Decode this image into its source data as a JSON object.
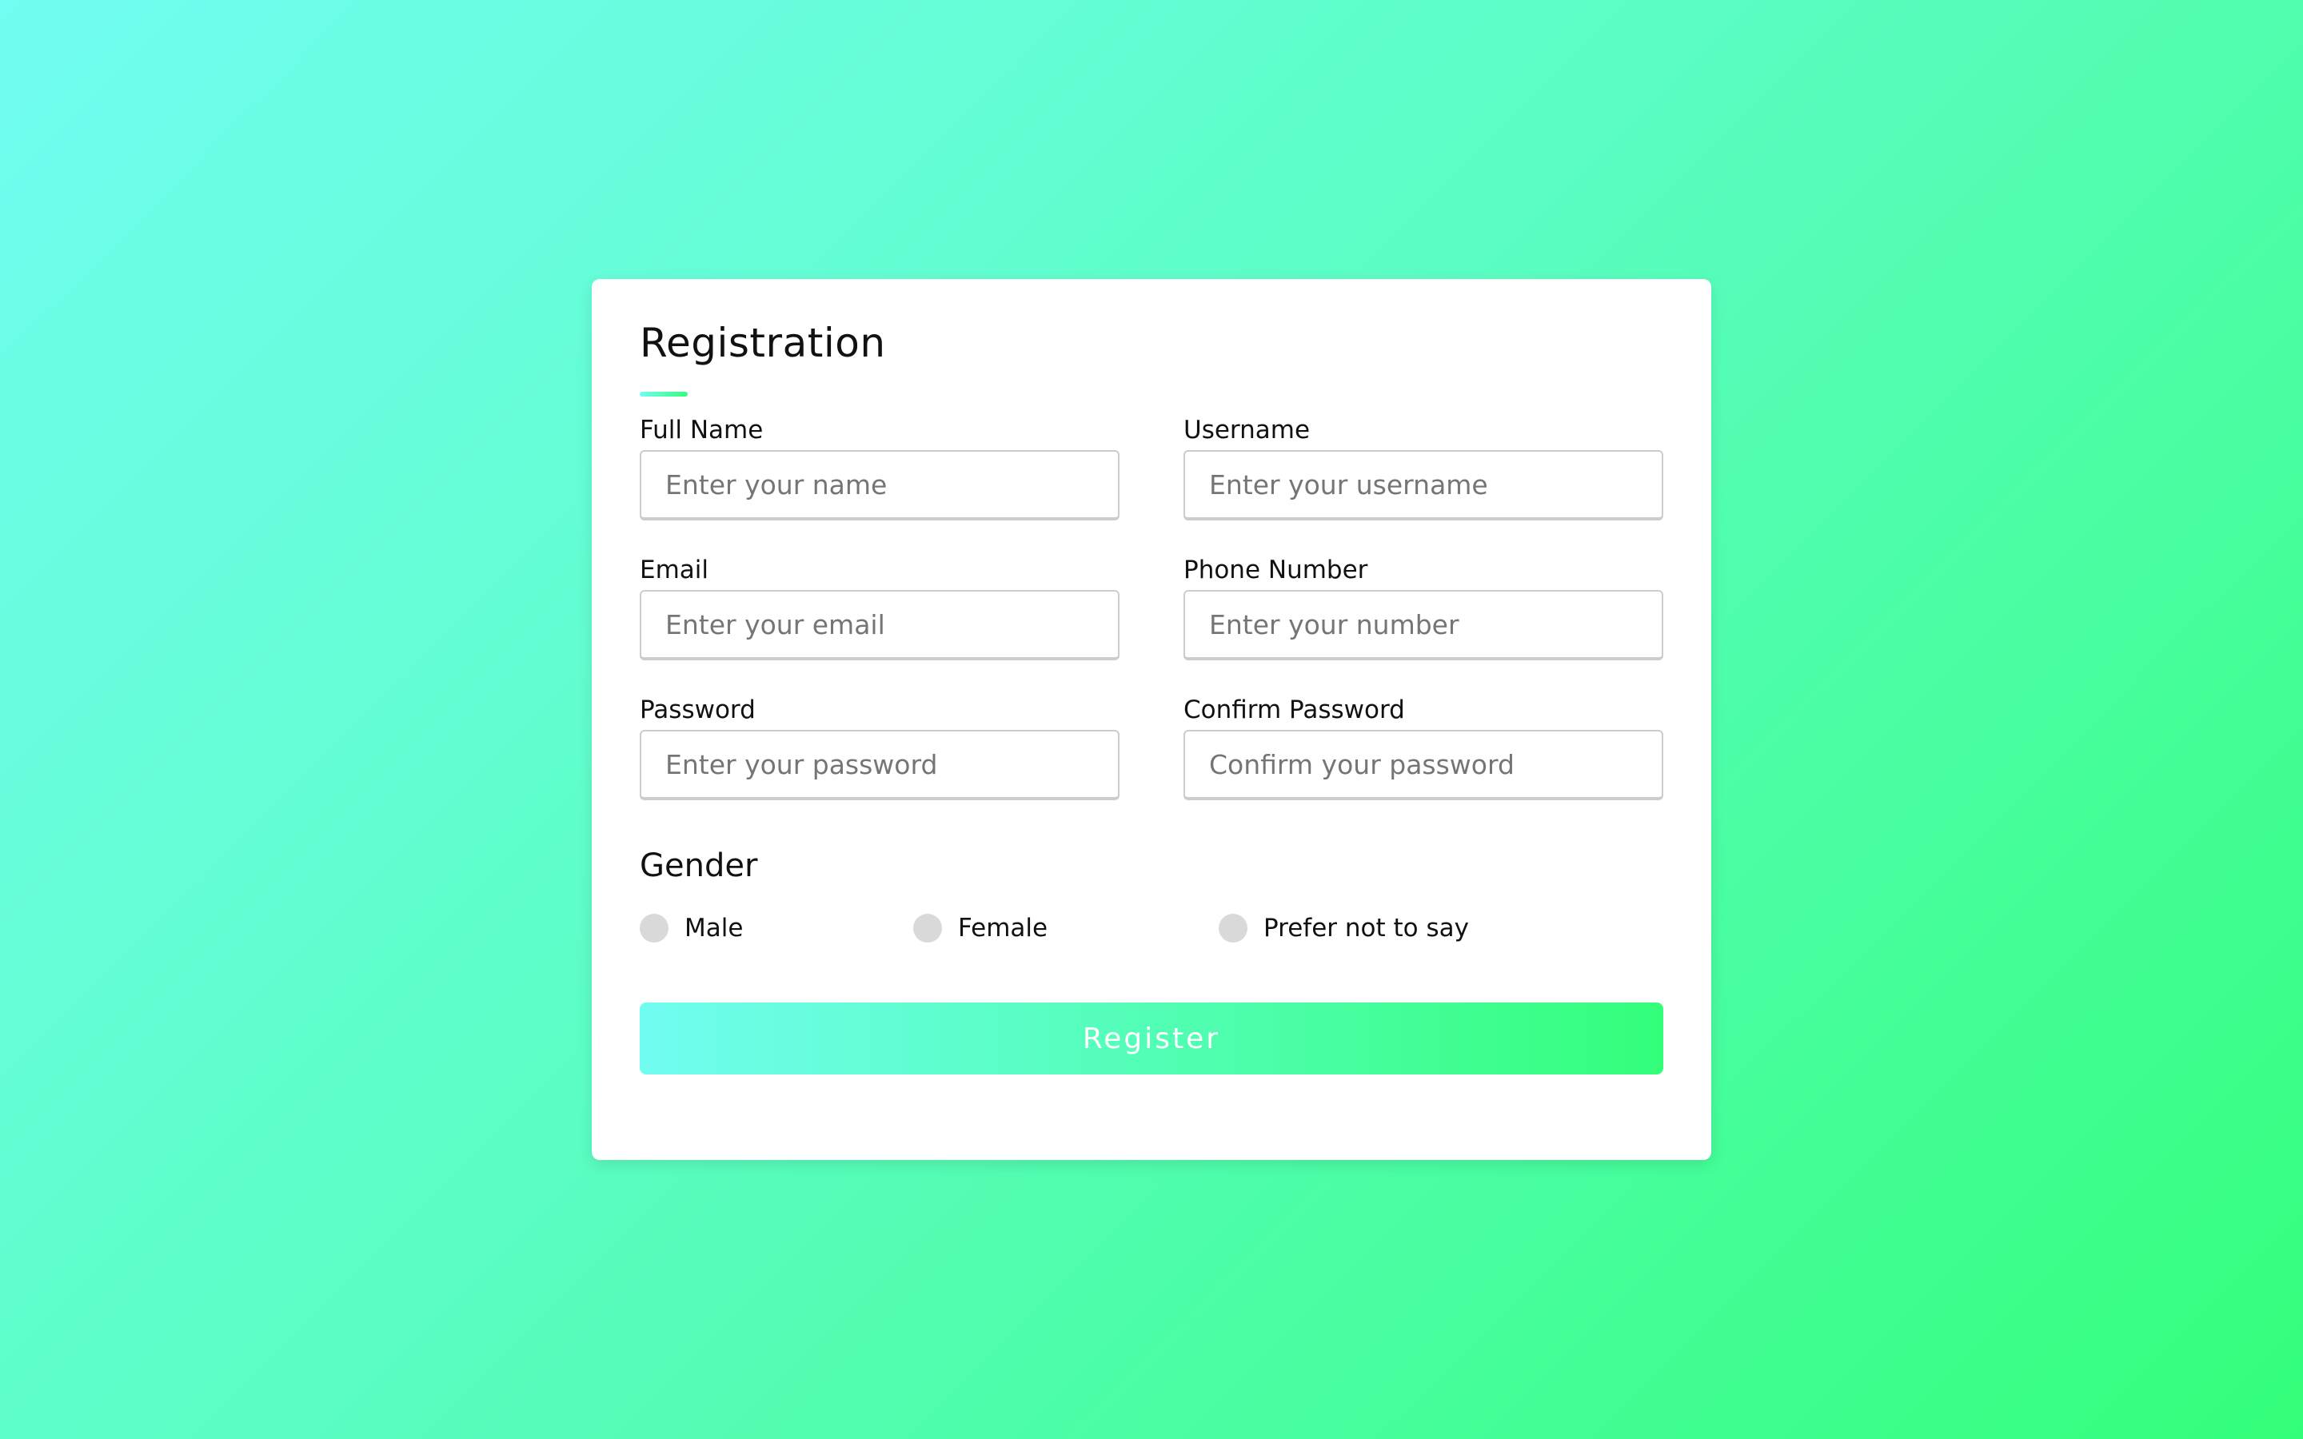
{
  "form": {
    "title": "Registration",
    "fields": [
      {
        "label": "Full Name",
        "placeholder": "Enter your name"
      },
      {
        "label": "Username",
        "placeholder": "Enter your username"
      },
      {
        "label": "Email",
        "placeholder": "Enter your email"
      },
      {
        "label": "Phone Number",
        "placeholder": "Enter your number"
      },
      {
        "label": "Password",
        "placeholder": "Enter your password"
      },
      {
        "label": "Confirm Password",
        "placeholder": "Confirm your password"
      }
    ],
    "gender": {
      "title": "Gender",
      "options": [
        "Male",
        "Female",
        "Prefer not to say"
      ]
    },
    "submit_label": "Register"
  },
  "colors": {
    "gradient_start": "#71fdf1",
    "gradient_end": "#33fe7a",
    "radio_unselected": "#d9d9d9",
    "card_background": "#ffffff"
  }
}
